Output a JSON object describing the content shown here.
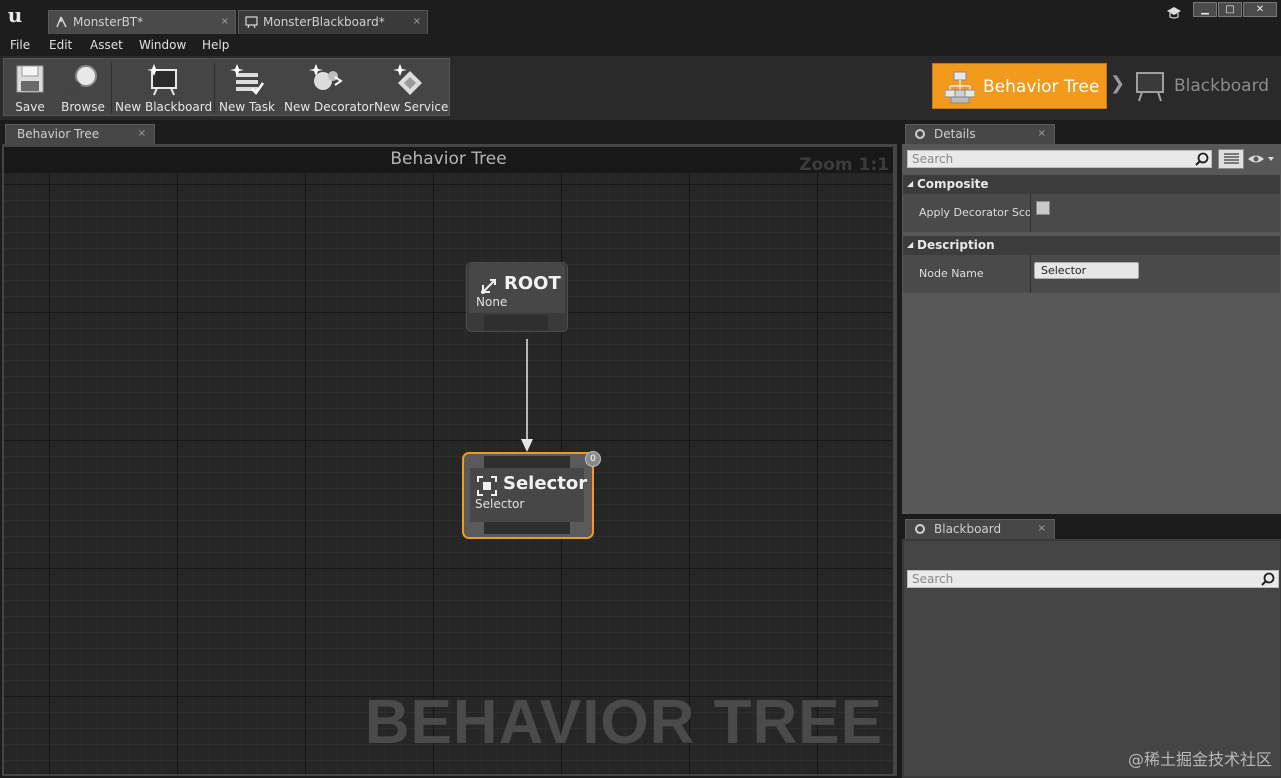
{
  "window": {
    "tabs": [
      {
        "label": "MonsterBT*"
      },
      {
        "label": "MonsterBlackboard*"
      }
    ],
    "min_glyph": "▁",
    "max_glyph": "□",
    "close_glyph": "✕",
    "close_tab_glyph": "×"
  },
  "menu": {
    "items": [
      "File",
      "Edit",
      "Asset",
      "Window",
      "Help"
    ]
  },
  "toolbar": {
    "save": "Save",
    "browse": "Browse",
    "new_blackboard": "New Blackboard",
    "new_task": "New Task",
    "new_decorator": "New Decorator",
    "new_service": "New Service"
  },
  "modes": {
    "behavior_tree": "Behavior Tree",
    "chevron": "❯",
    "blackboard": "Blackboard"
  },
  "graph": {
    "tab_label": "Behavior Tree",
    "title": "Behavior Tree",
    "zoom": "Zoom 1:1",
    "watermark": "BEHAVIOR TREE",
    "root_node": {
      "title": "ROOT",
      "subtitle": "None"
    },
    "selector_node": {
      "title": "Selector",
      "subtitle": "Selector",
      "badge": "0"
    }
  },
  "details": {
    "tab_label": "Details",
    "search_placeholder": "Search",
    "categories": [
      {
        "title": "Composite",
        "props": [
          {
            "name": "Apply Decorator Scope"
          }
        ]
      },
      {
        "title": "Description",
        "props": [
          {
            "name": "Node Name",
            "value": "Selector"
          }
        ]
      }
    ]
  },
  "blackboard": {
    "tab_label": "Blackboard",
    "search_placeholder": "Search"
  },
  "site_watermark": "@稀土掘金技术社区",
  "colors": {
    "accent": "#f19a1b",
    "graph_bg": "#262626",
    "panel_bg": "#585858"
  }
}
